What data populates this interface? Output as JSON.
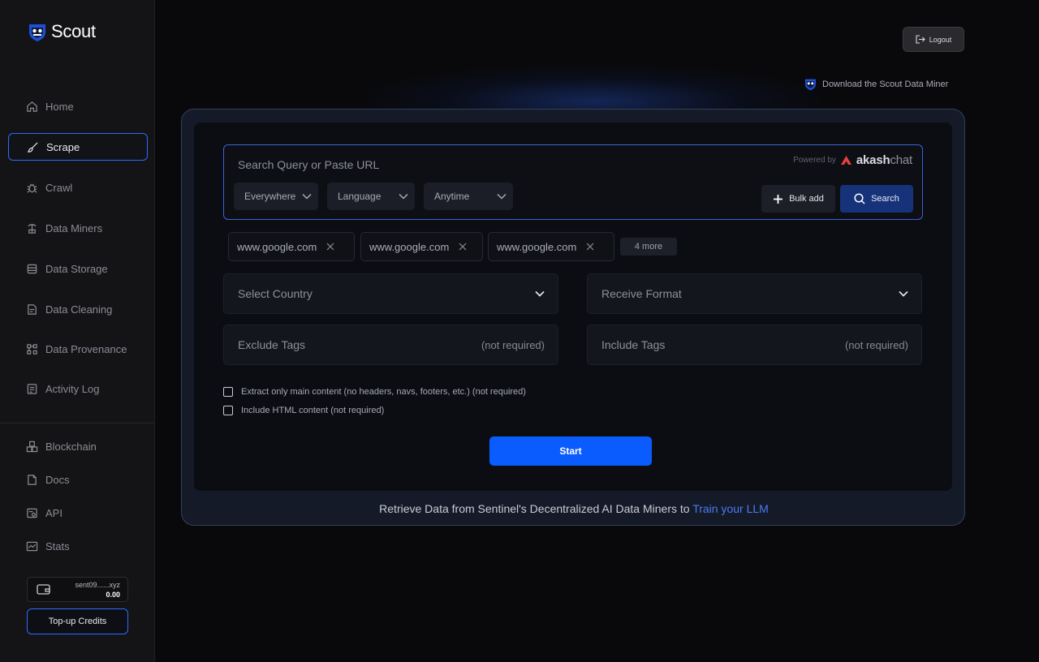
{
  "app": {
    "name": "Scout"
  },
  "sidebar": {
    "items": [
      {
        "label": "Home",
        "icon": "home-icon",
        "active": false
      },
      {
        "label": "Scrape",
        "icon": "brush-icon",
        "active": true
      },
      {
        "label": "Crawl",
        "icon": "bug-icon",
        "active": false
      },
      {
        "label": "Data Miners",
        "icon": "miner-icon",
        "active": false
      },
      {
        "label": "Data Storage",
        "icon": "storage-icon",
        "active": false
      },
      {
        "label": "Data Cleaning",
        "icon": "cleaning-icon",
        "active": false
      },
      {
        "label": "Data Provenance",
        "icon": "provenance-icon",
        "active": false
      },
      {
        "label": "Activity Log",
        "icon": "activity-log-icon",
        "active": false
      }
    ],
    "secondary": [
      {
        "label": "Blockchain",
        "icon": "blockchain-icon"
      },
      {
        "label": "Docs",
        "icon": "docs-icon"
      },
      {
        "label": "API",
        "icon": "api-icon"
      },
      {
        "label": "Stats",
        "icon": "stats-icon"
      }
    ],
    "wallet": {
      "address": "sent09......xyz",
      "balance": "0.00"
    },
    "topup_label": "Top-up Credits"
  },
  "header": {
    "logout_label": "Logout",
    "download_label": "Download the Scout Data Miner"
  },
  "search": {
    "placeholder": "Search Query or Paste URL",
    "powered_by": "Powered by",
    "brand": "akash",
    "brand_suffix": "chat",
    "filters": [
      "Everywhere",
      "Language",
      "Anytime"
    ],
    "bulk_add_label": "Bulk add",
    "search_label": "Search"
  },
  "urls": {
    "chips": [
      "www.google.com",
      "www.google.com",
      "www.google.com"
    ],
    "more_label": "4 more"
  },
  "form": {
    "country_placeholder": "Select Country",
    "format_placeholder": "Receive Format",
    "exclude_tags": "Exclude Tags",
    "include_tags": "Include Tags",
    "not_required": "(not required)",
    "check_main_content": "Extract only main content (no headers, navs, footers, etc.)  (not required)",
    "check_html": "Include HTML content  (not required)",
    "start_label": "Start"
  },
  "footer": {
    "tagline": "Retrieve Data from Sentinel's Decentralized AI Data Miners to ",
    "tagline_link": "Train your LLM"
  },
  "colors": {
    "accent": "#0b5cff",
    "active_border": "#2f6bff",
    "background": "#09090b"
  }
}
